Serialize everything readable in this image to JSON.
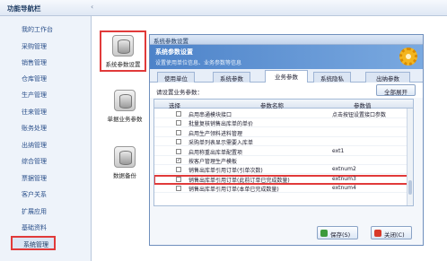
{
  "topbar": {
    "title": "功能导航栏"
  },
  "sidebar": {
    "items": [
      {
        "label": "我的工作台"
      },
      {
        "label": "采购管理"
      },
      {
        "label": "销售管理"
      },
      {
        "label": "仓库管理"
      },
      {
        "label": "生产管理"
      },
      {
        "label": "往来管理"
      },
      {
        "label": "账务处理"
      },
      {
        "label": "出纳管理"
      },
      {
        "label": "综合管理"
      },
      {
        "label": "票据管理"
      },
      {
        "label": "客户关系"
      },
      {
        "label": "扩展应用"
      },
      {
        "label": "基础资料"
      },
      {
        "label": "系统管理"
      }
    ]
  },
  "iconcol": {
    "items": [
      {
        "label": "系统参数设置"
      },
      {
        "label": "单据业务参数"
      },
      {
        "label": "数据备份"
      }
    ]
  },
  "dialog": {
    "title": "系统参数设置",
    "banner_title": "系统参数设置",
    "banner_sub": "设置使用单位信息、业务参数等信息",
    "tabs": [
      "使用单位",
      "系统参数",
      "业务参数",
      "系统隐私",
      "出纳参数"
    ],
    "hint": "请设置业务参数：",
    "expand_label": "全部展开",
    "columns": {
      "select": "选择",
      "name": "参数名称",
      "value": "参数值"
    },
    "rows": [
      {
        "name": "启用串通模块接口",
        "value": "点击按钮设置接口参数",
        "checked": false
      },
      {
        "name": "批量复核销售出库单的单价",
        "value": "",
        "checked": false
      },
      {
        "name": "启用生产领料进料管理",
        "value": "",
        "checked": false
      },
      {
        "name": "采购单列表显示需要入库单",
        "value": "",
        "checked": false
      },
      {
        "name": "启用称重出库单配置项",
        "value": "ext1",
        "checked": false
      },
      {
        "name": "按客户管理生产模板",
        "value": "",
        "checked": true
      },
      {
        "name": "销售出库单引用订单(引单次数)",
        "value": "extnum2",
        "checked": false
      },
      {
        "name": "销售出库单引用订单(此前订单已完成数量)",
        "value": "extnum3",
        "checked": false
      },
      {
        "name": "销售出库单引用订单(本单已完成数量)",
        "value": "extnum4",
        "checked": false
      }
    ],
    "save_label": "保存(S)",
    "close_label": "关闭(C)"
  }
}
